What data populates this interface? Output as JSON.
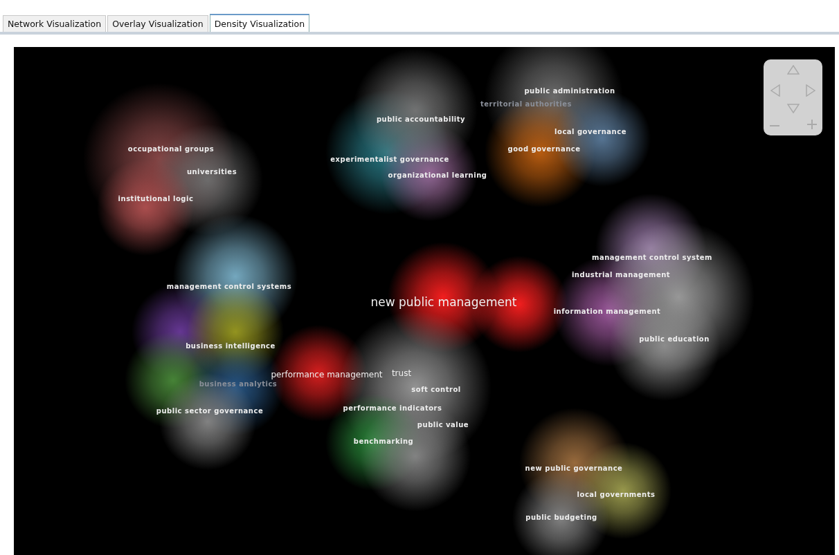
{
  "tabs": [
    {
      "label": "Network Visualization",
      "selected": false
    },
    {
      "label": "Overlay Visualization",
      "selected": false
    },
    {
      "label": "Density Visualization",
      "selected": true
    }
  ],
  "map": {
    "terms": [
      {
        "label": "public administration",
        "kind": "term",
        "faint": false
      },
      {
        "label": "territorial authorities",
        "kind": "term",
        "faint": true
      },
      {
        "label": "public accountability",
        "kind": "term",
        "faint": false
      },
      {
        "label": "local governance",
        "kind": "term",
        "faint": false
      },
      {
        "label": "occupational groups",
        "kind": "term",
        "faint": false
      },
      {
        "label": "good governance",
        "kind": "term",
        "faint": false
      },
      {
        "label": "experimentalist governance",
        "kind": "term",
        "faint": false
      },
      {
        "label": "universities",
        "kind": "term",
        "faint": false
      },
      {
        "label": "organizational learning",
        "kind": "term",
        "faint": false
      },
      {
        "label": "institutional logic",
        "kind": "term",
        "faint": false
      },
      {
        "label": "management control system",
        "kind": "term",
        "faint": false
      },
      {
        "label": "industrial management",
        "kind": "term",
        "faint": false
      },
      {
        "label": "management control systems",
        "kind": "term",
        "faint": false
      },
      {
        "label": "new public management",
        "kind": "major",
        "faint": false
      },
      {
        "label": "information management",
        "kind": "term",
        "faint": false
      },
      {
        "label": "public education",
        "kind": "term",
        "faint": false
      },
      {
        "label": "business intelligence",
        "kind": "term",
        "faint": false
      },
      {
        "label": "performance management",
        "kind": "medium",
        "faint": false
      },
      {
        "label": "trust",
        "kind": "medium",
        "faint": false
      },
      {
        "label": "business analytics",
        "kind": "term",
        "faint": true
      },
      {
        "label": "soft control",
        "kind": "term",
        "faint": false
      },
      {
        "label": "public sector governance",
        "kind": "term",
        "faint": false
      },
      {
        "label": "performance indicators",
        "kind": "term",
        "faint": false
      },
      {
        "label": "public value",
        "kind": "term",
        "faint": false
      },
      {
        "label": "benchmarking",
        "kind": "term",
        "faint": false
      },
      {
        "label": "new public governance",
        "kind": "term",
        "faint": false
      },
      {
        "label": "local governments",
        "kind": "term",
        "faint": false
      },
      {
        "label": "public budgeting",
        "kind": "term",
        "faint": false
      }
    ]
  }
}
